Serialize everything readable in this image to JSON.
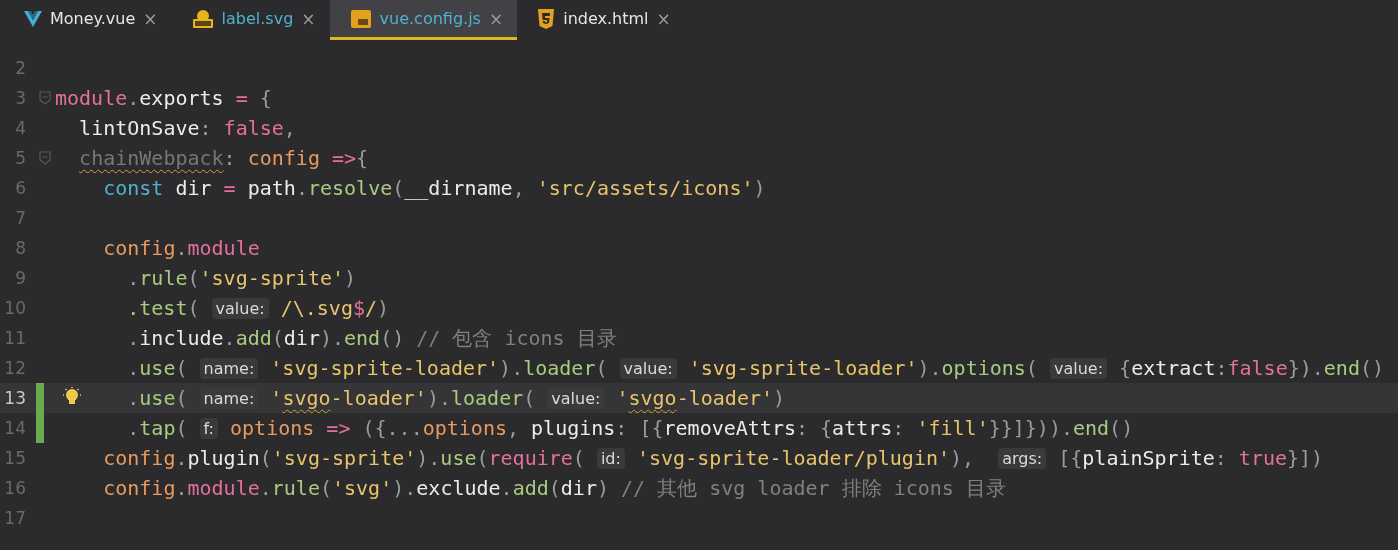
{
  "tabs": [
    {
      "label": "Money.vue",
      "kind": "vue",
      "modified": false,
      "selected": false,
      "close": "×"
    },
    {
      "label": "label.svg",
      "kind": "svg",
      "modified": true,
      "selected": false,
      "close": "×"
    },
    {
      "label": "vue.config.js",
      "kind": "js",
      "modified": true,
      "selected": true,
      "close": "×"
    },
    {
      "label": "index.html",
      "kind": "html",
      "modified": false,
      "selected": false,
      "close": "×"
    }
  ],
  "editor": {
    "lines": [
      {
        "number": "2",
        "current": false,
        "changed": false,
        "fold": false,
        "bulb": false
      },
      {
        "number": "3",
        "current": false,
        "changed": false,
        "fold": true,
        "bulb": false,
        "segments": [
          {
            "kind": "code",
            "t": "module",
            "color": "#e5709a"
          },
          {
            "kind": "code",
            "t": ".",
            "color": "#9c9c9c"
          },
          {
            "kind": "code",
            "t": "exports ",
            "color": "#ececec"
          },
          {
            "kind": "code",
            "t": "=",
            "color": "#e5709a"
          },
          {
            "kind": "code",
            "t": " {",
            "color": "#9c9c9c"
          }
        ]
      },
      {
        "number": "4",
        "current": false,
        "changed": false,
        "fold": false,
        "bulb": false,
        "segments": [
          {
            "kind": "code",
            "t": "  lintOnSave",
            "color": "#ececec"
          },
          {
            "kind": "code",
            "t": ": ",
            "color": "#9c9c9c"
          },
          {
            "kind": "code",
            "t": "false",
            "color": "#e5709a"
          },
          {
            "kind": "code",
            "t": ",",
            "color": "#9c9c9c"
          }
        ]
      },
      {
        "number": "5",
        "current": false,
        "changed": false,
        "fold": true,
        "bulb": false,
        "segments": [
          {
            "kind": "code",
            "t": "  chainWebpack",
            "color": "#777777",
            "squiggle": true
          },
          {
            "kind": "code",
            "t": ": ",
            "color": "#9c9c9c"
          },
          {
            "kind": "code",
            "t": "config",
            "color": "#e99a5c"
          },
          {
            "kind": "code",
            "t": " =>",
            "color": "#e5709a"
          },
          {
            "kind": "code",
            "t": "{",
            "color": "#9c9c9c"
          }
        ]
      },
      {
        "number": "6",
        "current": false,
        "changed": false,
        "fold": false,
        "bulb": false,
        "segments": [
          {
            "kind": "code",
            "t": "    const",
            "color": "#4fb3cf"
          },
          {
            "kind": "code",
            "t": " dir ",
            "color": "#ececec"
          },
          {
            "kind": "code",
            "t": "=",
            "color": "#e5709a"
          },
          {
            "kind": "code",
            "t": " path",
            "color": "#ececec"
          },
          {
            "kind": "code",
            "t": ".",
            "color": "#9c9c9c"
          },
          {
            "kind": "code",
            "t": "resolve",
            "color": "#a9cd7d"
          },
          {
            "kind": "code",
            "t": "(",
            "color": "#9c9c9c"
          },
          {
            "kind": "code",
            "t": "__dirname",
            "color": "#ececec"
          },
          {
            "kind": "code",
            "t": ", ",
            "color": "#9c9c9c"
          },
          {
            "kind": "code",
            "t": "'src/assets/icons'",
            "color": "#e8c46a"
          },
          {
            "kind": "code",
            "t": ")",
            "color": "#9c9c9c"
          }
        ]
      },
      {
        "number": "7",
        "current": false,
        "changed": false,
        "fold": false,
        "bulb": false
      },
      {
        "number": "8",
        "current": false,
        "changed": false,
        "fold": false,
        "bulb": false,
        "segments": [
          {
            "kind": "code",
            "t": "    config",
            "color": "#e99a5c"
          },
          {
            "kind": "code",
            "t": ".",
            "color": "#9c9c9c"
          },
          {
            "kind": "code",
            "t": "module",
            "color": "#e5709a"
          }
        ]
      },
      {
        "number": "9",
        "current": false,
        "changed": false,
        "fold": false,
        "bulb": false,
        "segments": [
          {
            "kind": "code",
            "t": "      .",
            "color": "#9c9c9c"
          },
          {
            "kind": "code",
            "t": "rule",
            "color": "#a9cd7d"
          },
          {
            "kind": "code",
            "t": "(",
            "color": "#9c9c9c"
          },
          {
            "kind": "code",
            "t": "'svg-sprite'",
            "color": "#e8c46a"
          },
          {
            "kind": "code",
            "t": ")",
            "color": "#9c9c9c"
          }
        ]
      },
      {
        "number": "10",
        "current": false,
        "changed": false,
        "fold": false,
        "bulb": false,
        "segments": [
          {
            "kind": "code",
            "t": "      .test",
            "color": "#a9cd7d"
          },
          {
            "kind": "code",
            "t": "( ",
            "color": "#9c9c9c"
          },
          {
            "kind": "hint",
            "t": "value:"
          },
          {
            "kind": "code",
            "t": " /\\.svg",
            "color": "#e8c46a"
          },
          {
            "kind": "code",
            "t": "$",
            "color": "#e5709a"
          },
          {
            "kind": "code",
            "t": "/",
            "color": "#e8c46a"
          },
          {
            "kind": "code",
            "t": ")",
            "color": "#9c9c9c"
          }
        ]
      },
      {
        "number": "11",
        "current": false,
        "changed": false,
        "fold": false,
        "bulb": false,
        "segments": [
          {
            "kind": "code",
            "t": "      .",
            "color": "#9c9c9c"
          },
          {
            "kind": "code",
            "t": "include",
            "color": "#ececec"
          },
          {
            "kind": "code",
            "t": ".",
            "color": "#9c9c9c"
          },
          {
            "kind": "code",
            "t": "add",
            "color": "#a9cd7d"
          },
          {
            "kind": "code",
            "t": "(",
            "color": "#9c9c9c"
          },
          {
            "kind": "code",
            "t": "dir",
            "color": "#ececec"
          },
          {
            "kind": "code",
            "t": ").",
            "color": "#9c9c9c"
          },
          {
            "kind": "code",
            "t": "end",
            "color": "#a9cd7d"
          },
          {
            "kind": "code",
            "t": "()",
            "color": "#9c9c9c"
          },
          {
            "kind": "code",
            "t": " // 包含 icons 目录",
            "color": "#808080"
          }
        ]
      },
      {
        "number": "12",
        "current": false,
        "changed": false,
        "fold": false,
        "bulb": false,
        "segments": [
          {
            "kind": "code",
            "t": "      .",
            "color": "#9c9c9c"
          },
          {
            "kind": "code",
            "t": "use",
            "color": "#a9cd7d"
          },
          {
            "kind": "code",
            "t": "( ",
            "color": "#9c9c9c"
          },
          {
            "kind": "hint",
            "t": "name:"
          },
          {
            "kind": "code",
            "t": " 'svg-sprite-loader'",
            "color": "#e8c46a"
          },
          {
            "kind": "code",
            "t": ").",
            "color": "#9c9c9c"
          },
          {
            "kind": "code",
            "t": "loader",
            "color": "#a9cd7d"
          },
          {
            "kind": "code",
            "t": "( ",
            "color": "#9c9c9c"
          },
          {
            "kind": "hint",
            "t": "value:"
          },
          {
            "kind": "code",
            "t": " 'svg-sprite-loader'",
            "color": "#e8c46a"
          },
          {
            "kind": "code",
            "t": ").",
            "color": "#9c9c9c"
          },
          {
            "kind": "code",
            "t": "options",
            "color": "#a9cd7d"
          },
          {
            "kind": "code",
            "t": "( ",
            "color": "#9c9c9c"
          },
          {
            "kind": "hint",
            "t": "value:"
          },
          {
            "kind": "code",
            "t": " {",
            "color": "#9c9c9c"
          },
          {
            "kind": "code",
            "t": "extract",
            "color": "#ececec"
          },
          {
            "kind": "code",
            "t": ":",
            "color": "#9c9c9c"
          },
          {
            "kind": "code",
            "t": "false",
            "color": "#e5709a"
          },
          {
            "kind": "code",
            "t": "}).",
            "color": "#9c9c9c"
          },
          {
            "kind": "code",
            "t": "end",
            "color": "#a9cd7d"
          },
          {
            "kind": "code",
            "t": "()",
            "color": "#9c9c9c"
          }
        ]
      },
      {
        "number": "13",
        "current": true,
        "changed": true,
        "fold": false,
        "bulb": true,
        "segments": [
          {
            "kind": "code",
            "t": "      .",
            "color": "#9c9c9c"
          },
          {
            "kind": "code",
            "t": "use",
            "color": "#a9cd7d"
          },
          {
            "kind": "code",
            "t": "( ",
            "color": "#9c9c9c"
          },
          {
            "kind": "hint",
            "t": "name:"
          },
          {
            "kind": "code",
            "t": " '",
            "color": "#e8c46a"
          },
          {
            "kind": "code",
            "t": "svgo",
            "color": "#e8c46a",
            "squiggle": true
          },
          {
            "kind": "code",
            "t": "-loader'",
            "color": "#e8c46a"
          },
          {
            "kind": "code",
            "t": ").",
            "color": "#9c9c9c"
          },
          {
            "kind": "code",
            "t": "loader",
            "color": "#a9cd7d"
          },
          {
            "kind": "code",
            "t": "( ",
            "color": "#9c9c9c"
          },
          {
            "kind": "hint",
            "t": "value:"
          },
          {
            "kind": "code",
            "t": " '",
            "color": "#e8c46a"
          },
          {
            "kind": "code",
            "t": "svgo",
            "color": "#e8c46a",
            "squiggle": true
          },
          {
            "kind": "code",
            "t": "-loader'",
            "color": "#e8c46a"
          },
          {
            "kind": "code",
            "t": ")",
            "color": "#9c9c9c"
          }
        ]
      },
      {
        "number": "14",
        "current": false,
        "changed": true,
        "fold": false,
        "bulb": false,
        "segments": [
          {
            "kind": "code",
            "t": "      .",
            "color": "#9c9c9c"
          },
          {
            "kind": "code",
            "t": "tap",
            "color": "#a9cd7d"
          },
          {
            "kind": "code",
            "t": "( ",
            "color": "#9c9c9c"
          },
          {
            "kind": "hint",
            "t": "f:"
          },
          {
            "kind": "code",
            "t": " options",
            "color": "#e99a5c"
          },
          {
            "kind": "code",
            "t": " =>",
            "color": "#e5709a"
          },
          {
            "kind": "code",
            "t": " ({...",
            "color": "#9c9c9c"
          },
          {
            "kind": "code",
            "t": "options",
            "color": "#e99a5c"
          },
          {
            "kind": "code",
            "t": ", ",
            "color": "#9c9c9c"
          },
          {
            "kind": "code",
            "t": "plugins",
            "color": "#ececec"
          },
          {
            "kind": "code",
            "t": ": [{",
            "color": "#9c9c9c"
          },
          {
            "kind": "code",
            "t": "removeAttrs",
            "color": "#ececec"
          },
          {
            "kind": "code",
            "t": ": {",
            "color": "#9c9c9c"
          },
          {
            "kind": "code",
            "t": "attrs",
            "color": "#ececec"
          },
          {
            "kind": "code",
            "t": ": ",
            "color": "#9c9c9c"
          },
          {
            "kind": "code",
            "t": "'fill'",
            "color": "#e8c46a"
          },
          {
            "kind": "code",
            "t": "}}]})).",
            "color": "#9c9c9c"
          },
          {
            "kind": "code",
            "t": "end",
            "color": "#a9cd7d"
          },
          {
            "kind": "code",
            "t": "()",
            "color": "#9c9c9c"
          }
        ]
      },
      {
        "number": "15",
        "current": false,
        "changed": false,
        "fold": false,
        "bulb": false,
        "segments": [
          {
            "kind": "code",
            "t": "    config",
            "color": "#e99a5c"
          },
          {
            "kind": "code",
            "t": ".",
            "color": "#9c9c9c"
          },
          {
            "kind": "code",
            "t": "plugin",
            "color": "#ececec"
          },
          {
            "kind": "code",
            "t": "(",
            "color": "#9c9c9c"
          },
          {
            "kind": "code",
            "t": "'svg-sprite'",
            "color": "#e8c46a"
          },
          {
            "kind": "code",
            "t": ").",
            "color": "#9c9c9c"
          },
          {
            "kind": "code",
            "t": "use",
            "color": "#a9cd7d"
          },
          {
            "kind": "code",
            "t": "(",
            "color": "#9c9c9c"
          },
          {
            "kind": "code",
            "t": "require",
            "color": "#e5709a"
          },
          {
            "kind": "code",
            "t": "( ",
            "color": "#9c9c9c"
          },
          {
            "kind": "hint",
            "t": "id:"
          },
          {
            "kind": "code",
            "t": " 'svg-sprite-loader/plugin'",
            "color": "#e8c46a"
          },
          {
            "kind": "code",
            "t": "),  ",
            "color": "#9c9c9c"
          },
          {
            "kind": "hint",
            "t": "args:"
          },
          {
            "kind": "code",
            "t": " [{",
            "color": "#9c9c9c"
          },
          {
            "kind": "code",
            "t": "plainSprite",
            "color": "#ececec"
          },
          {
            "kind": "code",
            "t": ": ",
            "color": "#9c9c9c"
          },
          {
            "kind": "code",
            "t": "true",
            "color": "#e5709a"
          },
          {
            "kind": "code",
            "t": "}])",
            "color": "#9c9c9c"
          }
        ]
      },
      {
        "number": "16",
        "current": false,
        "changed": false,
        "fold": false,
        "bulb": false,
        "segments": [
          {
            "kind": "code",
            "t": "    config",
            "color": "#e99a5c"
          },
          {
            "kind": "code",
            "t": ".",
            "color": "#9c9c9c"
          },
          {
            "kind": "code",
            "t": "module",
            "color": "#e5709a"
          },
          {
            "kind": "code",
            "t": ".",
            "color": "#9c9c9c"
          },
          {
            "kind": "code",
            "t": "rule",
            "color": "#a9cd7d"
          },
          {
            "kind": "code",
            "t": "(",
            "color": "#9c9c9c"
          },
          {
            "kind": "code",
            "t": "'svg'",
            "color": "#e8c46a"
          },
          {
            "kind": "code",
            "t": ").",
            "color": "#9c9c9c"
          },
          {
            "kind": "code",
            "t": "exclude",
            "color": "#ececec"
          },
          {
            "kind": "code",
            "t": ".",
            "color": "#9c9c9c"
          },
          {
            "kind": "code",
            "t": "add",
            "color": "#a9cd7d"
          },
          {
            "kind": "code",
            "t": "(",
            "color": "#9c9c9c"
          },
          {
            "kind": "code",
            "t": "dir",
            "color": "#ececec"
          },
          {
            "kind": "code",
            "t": ")",
            "color": "#9c9c9c"
          },
          {
            "kind": "code",
            "t": " // 其他 svg loader 排除 icons 目录",
            "color": "#808080"
          }
        ]
      },
      {
        "number": "17",
        "current": false,
        "changed": false,
        "fold": false,
        "bulb": false
      }
    ]
  }
}
